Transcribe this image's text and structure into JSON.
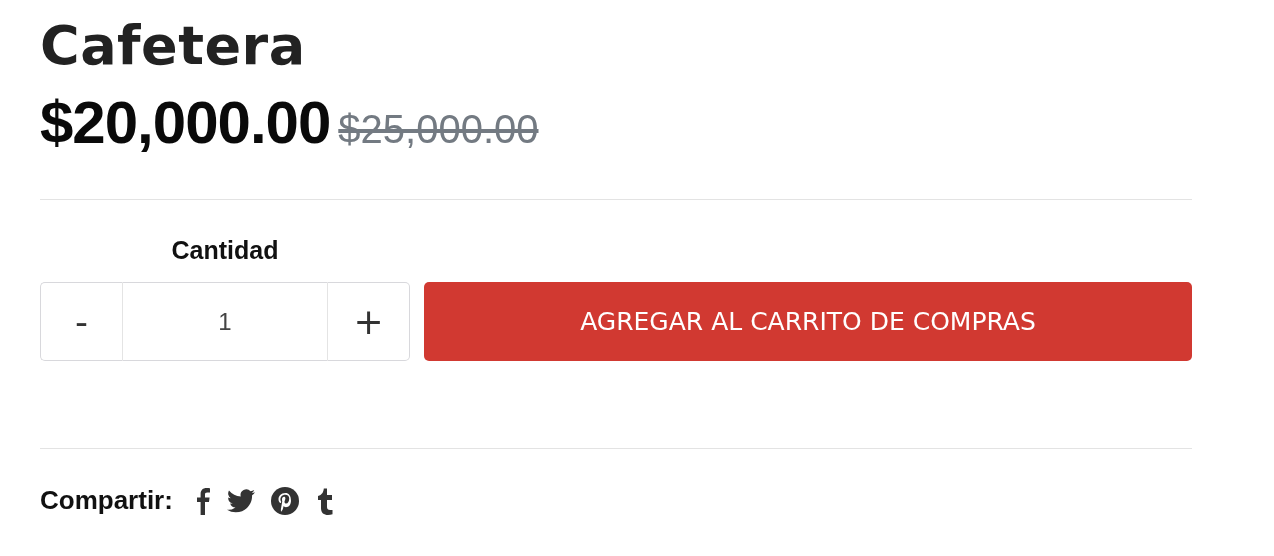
{
  "product": {
    "title": "Cafetera",
    "price": "$20,000.00",
    "old_price": "$25,000.00"
  },
  "quantity": {
    "label": "Cantidad",
    "decrement": "-",
    "value": "1",
    "increment": "+"
  },
  "add_to_cart": {
    "label": "AGREGAR AL CARRITO DE COMPRAS"
  },
  "share": {
    "label": "Compartir:",
    "links": [
      {
        "kind": "facebook"
      },
      {
        "kind": "twitter"
      },
      {
        "kind": "pinterest"
      },
      {
        "kind": "tumblr"
      }
    ]
  }
}
